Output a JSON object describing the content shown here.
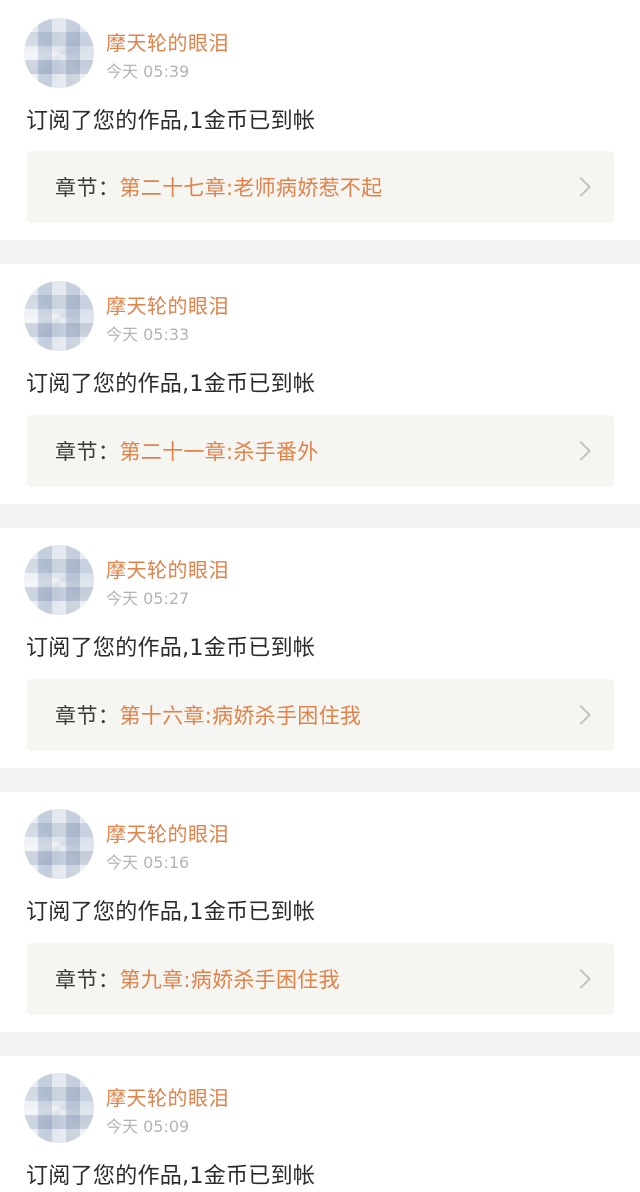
{
  "notifications": [
    {
      "username": "摩天轮的眼泪",
      "time": "今天 05:39",
      "message": "订阅了您的作品,1金币已到帐",
      "chapter_label": "章节：",
      "chapter_title": "第二十七章:老师病娇惹不起"
    },
    {
      "username": "摩天轮的眼泪",
      "time": "今天 05:33",
      "message": "订阅了您的作品,1金币已到帐",
      "chapter_label": "章节：",
      "chapter_title": "第二十一章:杀手番外"
    },
    {
      "username": "摩天轮的眼泪",
      "time": "今天 05:27",
      "message": "订阅了您的作品,1金币已到帐",
      "chapter_label": "章节：",
      "chapter_title": "第十六章:病娇杀手困住我"
    },
    {
      "username": "摩天轮的眼泪",
      "time": "今天 05:16",
      "message": "订阅了您的作品,1金币已到帐",
      "chapter_label": "章节：",
      "chapter_title": "第九章:病娇杀手困住我"
    },
    {
      "username": "摩天轮的眼泪",
      "time": "今天 05:09",
      "message": "订阅了您的作品,1金币已到帐"
    }
  ],
  "colors": {
    "accent": "#e0824a",
    "timestamp": "#b3b3b3",
    "chapter_bg": "#f5f5f1",
    "divider": "#f3f3f1"
  },
  "icons": {
    "avatar": "blurred-avatar",
    "chevron": "chevron-right-icon"
  }
}
